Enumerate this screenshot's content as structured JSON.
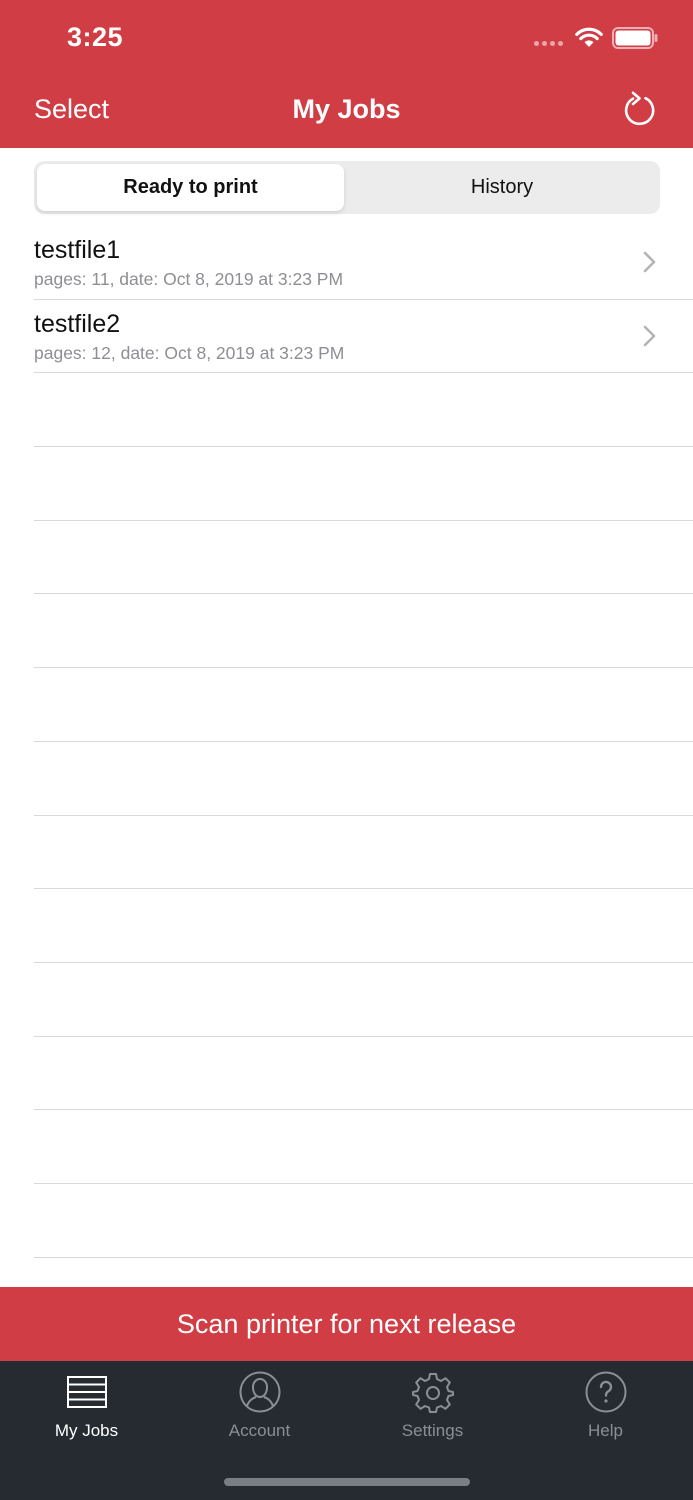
{
  "status_bar": {
    "time": "3:25"
  },
  "nav": {
    "select_label": "Select",
    "title": "My Jobs"
  },
  "segments": {
    "ready": "Ready to print",
    "history": "History"
  },
  "jobs": [
    {
      "name": "testfile1",
      "meta": "pages: 11, date: Oct 8, 2019 at 3:23 PM"
    },
    {
      "name": "testfile2",
      "meta": "pages: 12, date: Oct 8, 2019 at 3:23 PM"
    }
  ],
  "scan_label": "Scan printer for next release",
  "tabs": [
    {
      "label": "My Jobs",
      "icon": "list-icon",
      "active": true
    },
    {
      "label": "Account",
      "icon": "person-icon",
      "active": false
    },
    {
      "label": "Settings",
      "icon": "gear-icon",
      "active": false
    },
    {
      "label": "Help",
      "icon": "help-icon",
      "active": false
    }
  ],
  "colors": {
    "brand": "#d13d44",
    "tab_bar": "#262b31"
  }
}
